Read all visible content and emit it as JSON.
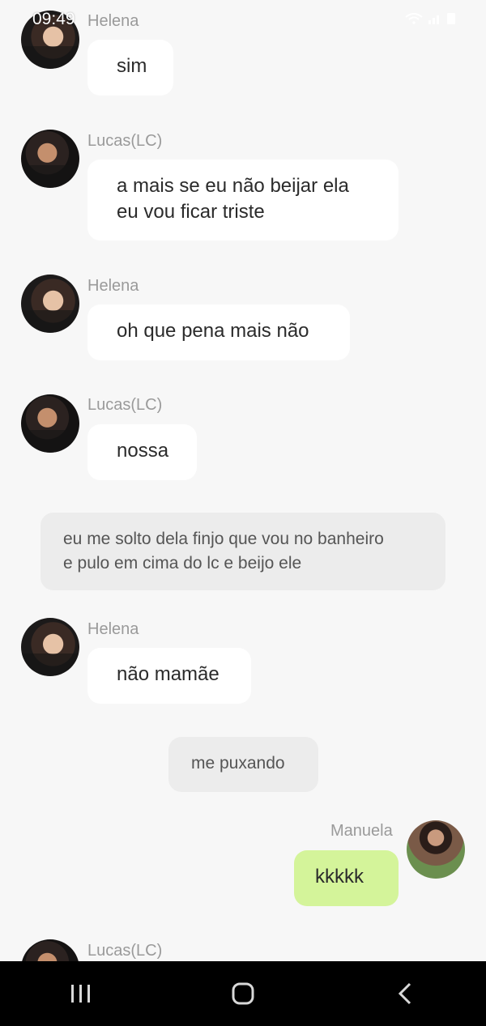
{
  "status_bar": {
    "time": "09:49"
  },
  "messages": [
    {
      "sender": "Helena",
      "text": "sim"
    },
    {
      "sender": "Lucas(LC)",
      "text_lines": [
        "a mais se eu não beijar ela",
        "eu vou ficar triste"
      ]
    },
    {
      "sender": "Helena",
      "text": "oh que pena mais não"
    },
    {
      "sender": "Lucas(LC)",
      "text": "nossa"
    },
    {
      "narration_lines": [
        "eu me solto dela finjo que vou no banheiro",
        "e pulo em cima do lc e beijo ele"
      ]
    },
    {
      "sender": "Helena",
      "text": "não mamãe"
    },
    {
      "narration": "me puxando"
    },
    {
      "sender": "Manuela",
      "text": "kkkkk",
      "own": true
    },
    {
      "sender": "Lucas(LC)"
    }
  ],
  "colors": {
    "background": "#f7f7f7",
    "bubble": "#ffffff",
    "own_bubble": "#d4f49a",
    "narration": "#ececec",
    "sender_name": "#9a9a9a",
    "nav_bar": "#000000"
  },
  "nav": {
    "icons": [
      "recent-apps-icon",
      "home-icon",
      "back-icon"
    ]
  }
}
